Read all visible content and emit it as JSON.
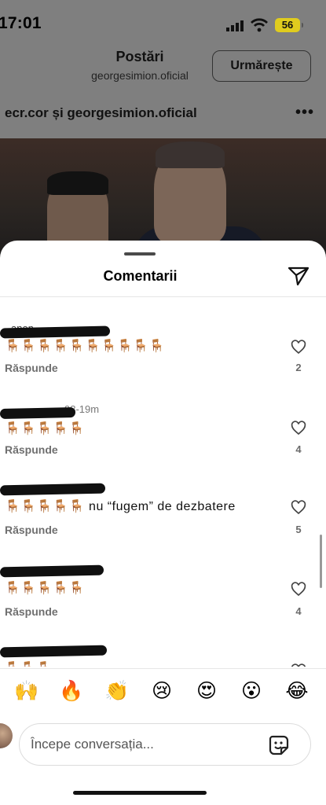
{
  "status_bar": {
    "time": "17:01",
    "battery": "56"
  },
  "header": {
    "title": "Postări",
    "username": "georgesimion.oficial",
    "follow_label": "Urmărește"
  },
  "post": {
    "authors": "ecr.cor și georgesimion.oficial",
    "more_icon": "more-horizontal-icon"
  },
  "sheet": {
    "title": "Comentarii"
  },
  "comments": [
    {
      "user": "anon",
      "time": "m",
      "text": "🪑🪑🪑🪑🪑🪑🪑🪑🪑🪑",
      "reply": "Răspunde",
      "likes": "2"
    },
    {
      "user": "_",
      "time": "98-19m",
      "text": "🪑🪑🪑🪑🪑",
      "reply": "Răspunde",
      "likes": "4"
    },
    {
      "user": "",
      "time": "",
      "text": "🪑🪑🪑🪑🪑 nu “fugem” de dezbatere",
      "reply": "Răspunde",
      "likes": "5"
    },
    {
      "user": "",
      "time": "",
      "text": "🪑🪑🪑🪑🪑",
      "reply": "Răspunde",
      "likes": "4"
    },
    {
      "user": "",
      "time": "",
      "text": "🪑🪑🪑",
      "reply": "",
      "likes": ""
    }
  ],
  "emoji_bar": [
    "🙌",
    "🔥",
    "👏",
    "😢",
    "😍",
    "😮",
    "😂"
  ],
  "composer": {
    "placeholder": "Începe conversația..."
  },
  "colors": {
    "dim_overlay": "#7f7f7f",
    "battery": "#e0cc1e",
    "secondary_text": "#6f6f6f"
  }
}
